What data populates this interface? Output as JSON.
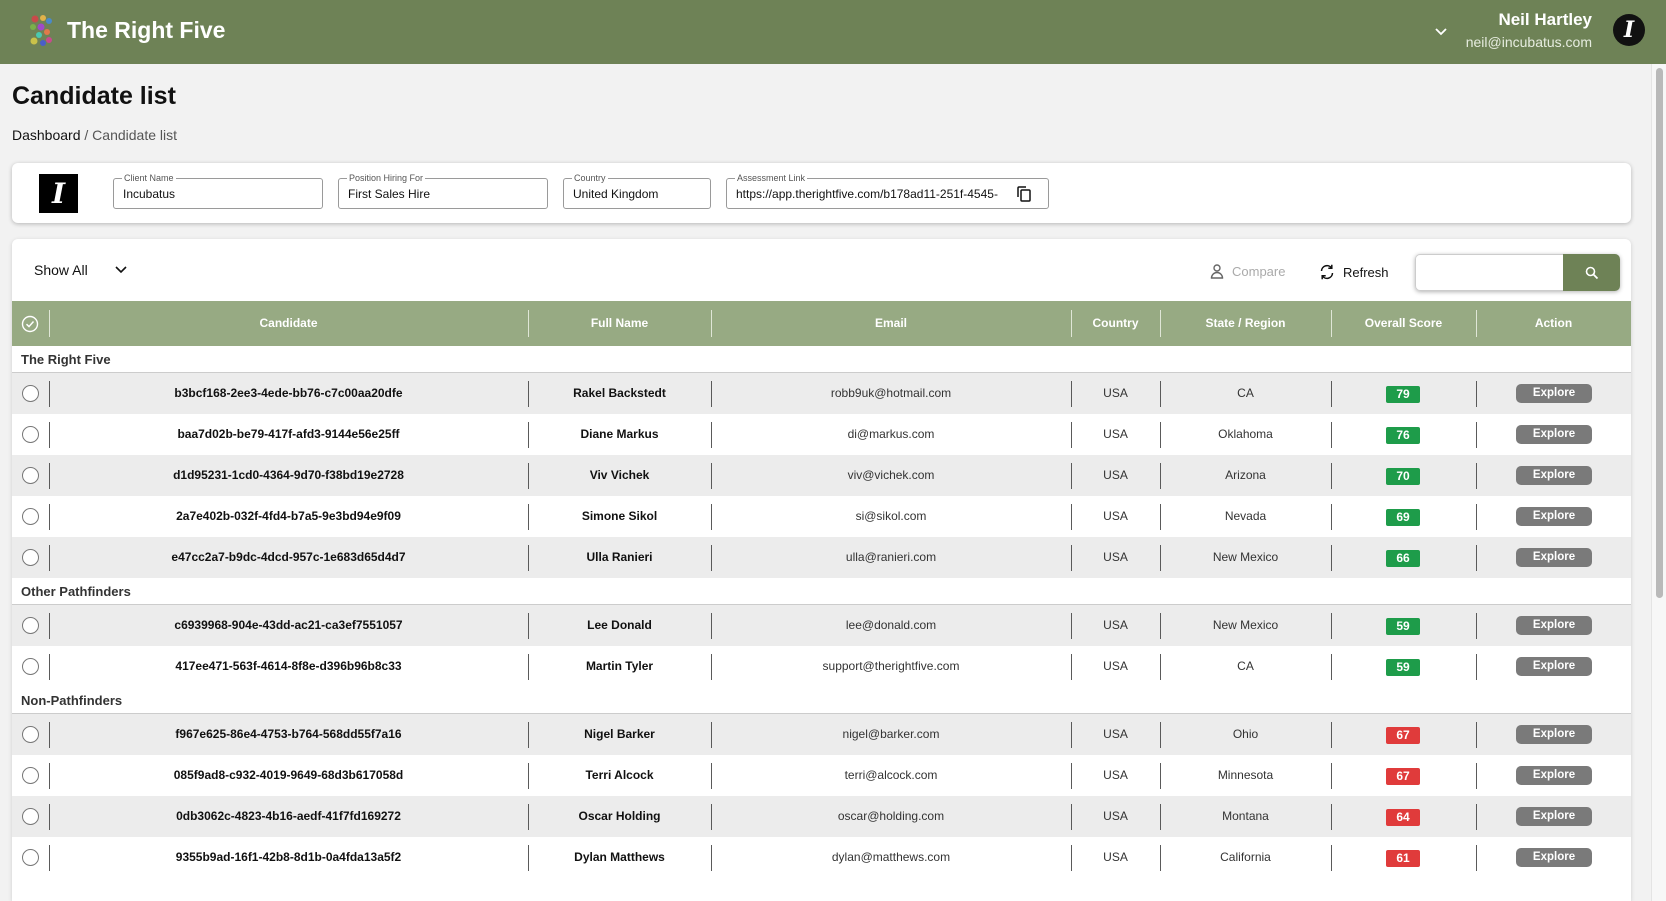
{
  "app": {
    "title": "The Right Five"
  },
  "user": {
    "name": "Neil Hartley",
    "email": "neil@incubatus.com",
    "avatar_letter": "I"
  },
  "page": {
    "title": "Candidate list",
    "breadcrumb": {
      "home": "Dashboard",
      "separator": " / ",
      "current": "Candidate list"
    }
  },
  "client": {
    "logo_letter": "I",
    "fields": [
      {
        "label": "Client Name",
        "value": "Incubatus"
      },
      {
        "label": "Position Hiring For",
        "value": "First Sales Hire"
      },
      {
        "label": "Country",
        "value": "United Kingdom"
      },
      {
        "label": "Assessment Link",
        "value": "https://app.therightfive.com/b178ad11-251f-4545-"
      }
    ]
  },
  "toolbar": {
    "filter_label": "Show All",
    "compare_label": "Compare",
    "refresh_label": "Refresh",
    "search_placeholder": ""
  },
  "columns": [
    "Candidate",
    "Full Name",
    "Email",
    "Country",
    "State / Region",
    "Overall Score",
    "Action"
  ],
  "explore_label": "Explore",
  "colors": {
    "brand": "#6e8256",
    "header": "#97aa83",
    "score_good": "#1e9c4a",
    "score_bad": "#e03b3b",
    "button": "#7a7a7a"
  },
  "groups": [
    {
      "name": "The Right Five",
      "rows": [
        {
          "candidate": "b3bcf168-2ee3-4ede-bb76-c7c00aa20dfe",
          "full_name": "Rakel Backstedt",
          "email": "robb9uk@hotmail.com",
          "country": "USA",
          "region": "CA",
          "score": "79",
          "score_status": "good"
        },
        {
          "candidate": "baa7d02b-be79-417f-afd3-9144e56e25ff",
          "full_name": "Diane Markus",
          "email": "di@markus.com",
          "country": "USA",
          "region": "Oklahoma",
          "score": "76",
          "score_status": "good"
        },
        {
          "candidate": "d1d95231-1cd0-4364-9d70-f38bd19e2728",
          "full_name": "Viv Vichek",
          "email": "viv@vichek.com",
          "country": "USA",
          "region": "Arizona",
          "score": "70",
          "score_status": "good"
        },
        {
          "candidate": "2a7e402b-032f-4fd4-b7a5-9e3bd94e9f09",
          "full_name": "Simone Sikol",
          "email": "si@sikol.com",
          "country": "USA",
          "region": "Nevada",
          "score": "69",
          "score_status": "good"
        },
        {
          "candidate": "e47cc2a7-b9dc-4dcd-957c-1e683d65d4d7",
          "full_name": "Ulla Ranieri",
          "email": "ulla@ranieri.com",
          "country": "USA",
          "region": "New Mexico",
          "score": "66",
          "score_status": "good"
        }
      ]
    },
    {
      "name": "Other Pathfinders",
      "rows": [
        {
          "candidate": "c6939968-904e-43dd-ac21-ca3ef7551057",
          "full_name": "Lee Donald",
          "email": "lee@donald.com",
          "country": "USA",
          "region": "New Mexico",
          "score": "59",
          "score_status": "good"
        },
        {
          "candidate": "417ee471-563f-4614-8f8e-d396b96b8c33",
          "full_name": "Martin Tyler",
          "email": "support@therightfive.com",
          "country": "USA",
          "region": "CA",
          "score": "59",
          "score_status": "good"
        }
      ]
    },
    {
      "name": "Non-Pathfinders",
      "rows": [
        {
          "candidate": "f967e625-86e4-4753-b764-568dd55f7a16",
          "full_name": "Nigel Barker",
          "email": "nigel@barker.com",
          "country": "USA",
          "region": "Ohio",
          "score": "67",
          "score_status": "bad"
        },
        {
          "candidate": "085f9ad8-c932-4019-9649-68d3b617058d",
          "full_name": "Terri Alcock",
          "email": "terri@alcock.com",
          "country": "USA",
          "region": "Minnesota",
          "score": "67",
          "score_status": "bad"
        },
        {
          "candidate": "0db3062c-4823-4b16-aedf-41f7fd169272",
          "full_name": "Oscar Holding",
          "email": "oscar@holding.com",
          "country": "USA",
          "region": "Montana",
          "score": "64",
          "score_status": "bad"
        },
        {
          "candidate": "9355b9ad-16f1-42b8-8d1b-0a4fda13a5f2",
          "full_name": "Dylan Matthews",
          "email": "dylan@matthews.com",
          "country": "USA",
          "region": "California",
          "score": "61",
          "score_status": "bad"
        }
      ]
    }
  ]
}
